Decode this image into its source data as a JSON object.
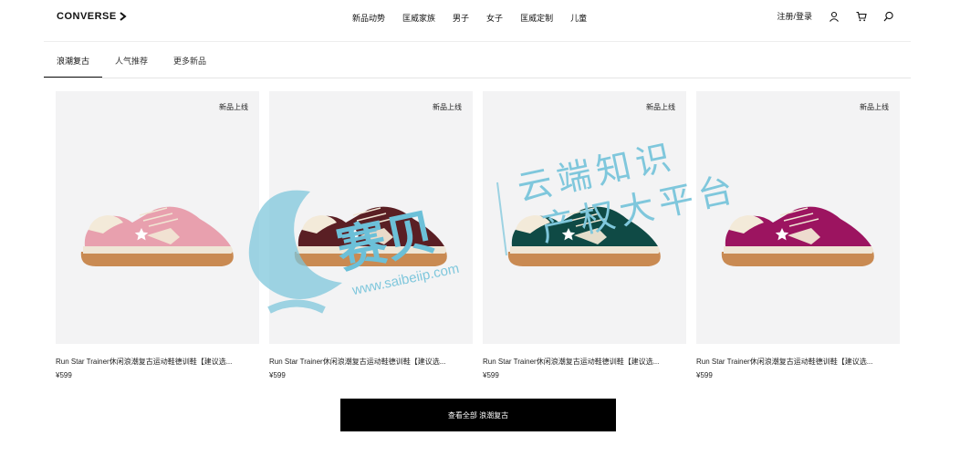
{
  "brand": {
    "logo_text": "CONVERSE"
  },
  "nav": {
    "items": [
      "新品动势",
      "匡威家族",
      "男子",
      "女子",
      "匡威定制",
      "儿童"
    ]
  },
  "actions": {
    "login_label": "注册/登录"
  },
  "tabs": [
    {
      "label": "浪潮复古",
      "active": true
    },
    {
      "label": "人气推荐",
      "active": false
    },
    {
      "label": "更多新品",
      "active": false
    }
  ],
  "products": [
    {
      "badge": "新品上线",
      "title": "Run Star Trainer休闲浪潮复古运动鞋德训鞋【建议选...",
      "price": "¥599",
      "color": "#e8a0ae"
    },
    {
      "badge": "新品上线",
      "title": "Run Star Trainer休闲浪潮复古运动鞋德训鞋【建议选...",
      "price": "¥599",
      "color": "#5a1f24"
    },
    {
      "badge": "新品上线",
      "title": "Run Star Trainer休闲浪潮复古运动鞋德训鞋【建议选...",
      "price": "¥599",
      "color": "#0f4a45"
    },
    {
      "badge": "新品上线",
      "title": "Run Star Trainer休闲浪潮复古运动鞋德训鞋【建议选...",
      "price": "¥599",
      "color": "#9c1460"
    }
  ],
  "cta": {
    "label": "查看全部 浪潮复古"
  },
  "watermark": {
    "brand": "赛贝",
    "line1": "云端知识",
    "line2": "产权大平台",
    "url": "www.saibeiip.com"
  }
}
